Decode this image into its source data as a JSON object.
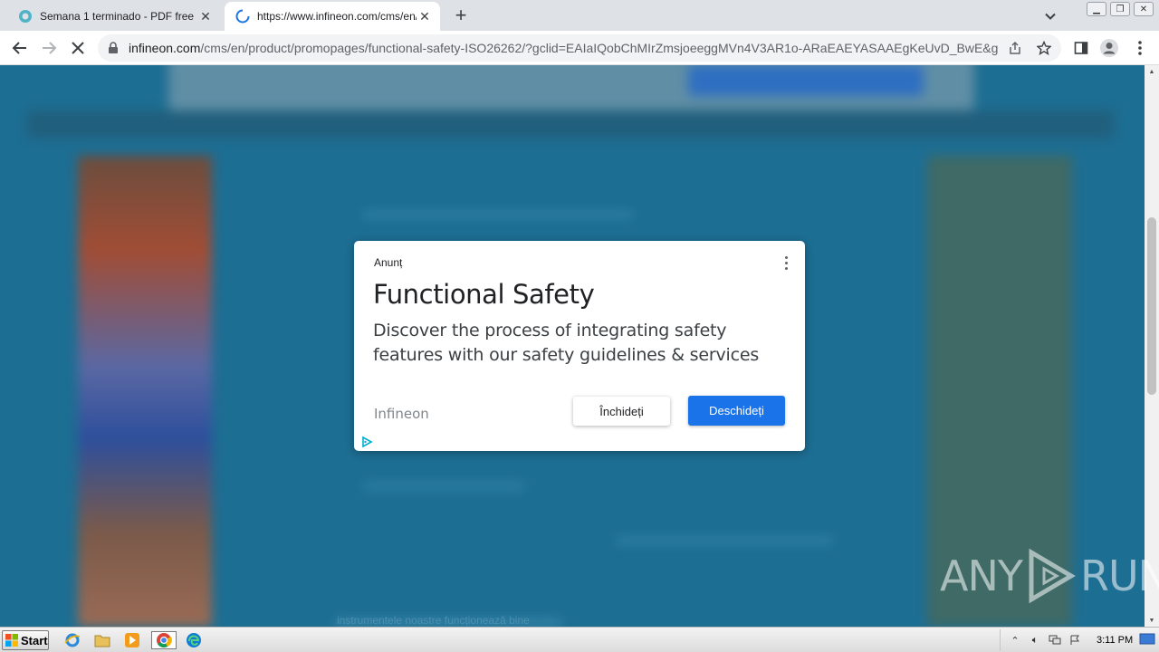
{
  "browser": {
    "tabs": [
      {
        "title": "Semana 1 terminado - PDF free",
        "active": false
      },
      {
        "title": "https://www.infineon.com/cms/en/p",
        "active": true
      }
    ],
    "address": {
      "domain": "infineon.com",
      "path": "/cms/en/product/promopages/functional-safety-ISO26262/?gclid=EAIaIQobChMIrZmsjoeeggMVn4V3AR1o-ARaEAEYASAAEgKeUvD_BwE&gcls..."
    }
  },
  "page": {
    "faint_text": "instrumentele noastre funcționează bine"
  },
  "ad": {
    "label": "Anunț",
    "headline": "Functional Safety",
    "description": "Discover the process of integrating safety features with our safety guidelines & services",
    "advertiser": "Infineon",
    "close_label": "Închideți",
    "open_label": "Deschideți",
    "accent_color": "#1a73e8"
  },
  "watermark": {
    "left": "ANY",
    "right": "RUN"
  },
  "taskbar": {
    "start_label": "Start",
    "clock": "3:11 PM"
  }
}
